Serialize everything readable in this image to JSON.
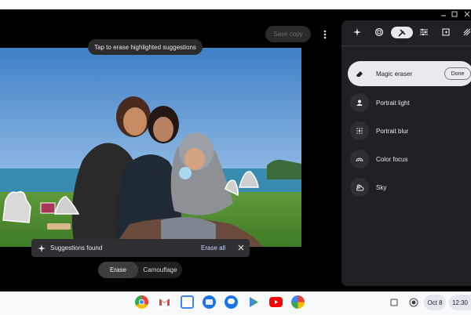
{
  "toolbar": {
    "save_copy_label": "Save copy"
  },
  "photo_hint": "Tap to erase highlighted suggestions",
  "snackbar": {
    "message": "Suggestions found",
    "action": "Erase all"
  },
  "mode": {
    "options": [
      "Erase",
      "Camouflage"
    ],
    "selected": "Erase"
  },
  "panel": {
    "tabs": [
      {
        "icon": "sparkle-icon",
        "active": false
      },
      {
        "icon": "rotate-crop-icon",
        "active": false
      },
      {
        "icon": "tools-icon",
        "active": true
      },
      {
        "icon": "adjust-sliders-icon",
        "active": false
      },
      {
        "icon": "filters-icon",
        "active": false
      },
      {
        "icon": "markup-icon",
        "active": false
      }
    ],
    "tools": [
      {
        "label": "Magic eraser",
        "icon": "eraser-icon",
        "active": true,
        "done_label": "Done"
      },
      {
        "label": "Portrait light",
        "icon": "portrait-light-icon"
      },
      {
        "label": "Portrait blur",
        "icon": "portrait-blur-icon"
      },
      {
        "label": "Color focus",
        "icon": "color-focus-icon"
      },
      {
        "label": "Sky",
        "icon": "sky-icon"
      }
    ]
  },
  "shelf": {
    "apps": [
      "chrome-icon",
      "gmail-icon",
      "calendar-icon",
      "files-icon",
      "messages-icon",
      "play-store-icon",
      "youtube-icon",
      "photos-icon"
    ],
    "date": "Oct 8",
    "time": "12:30"
  },
  "colors": {
    "accent": "#c5d6ff",
    "panel": "#202124",
    "active_chip": "#e8eaed"
  }
}
